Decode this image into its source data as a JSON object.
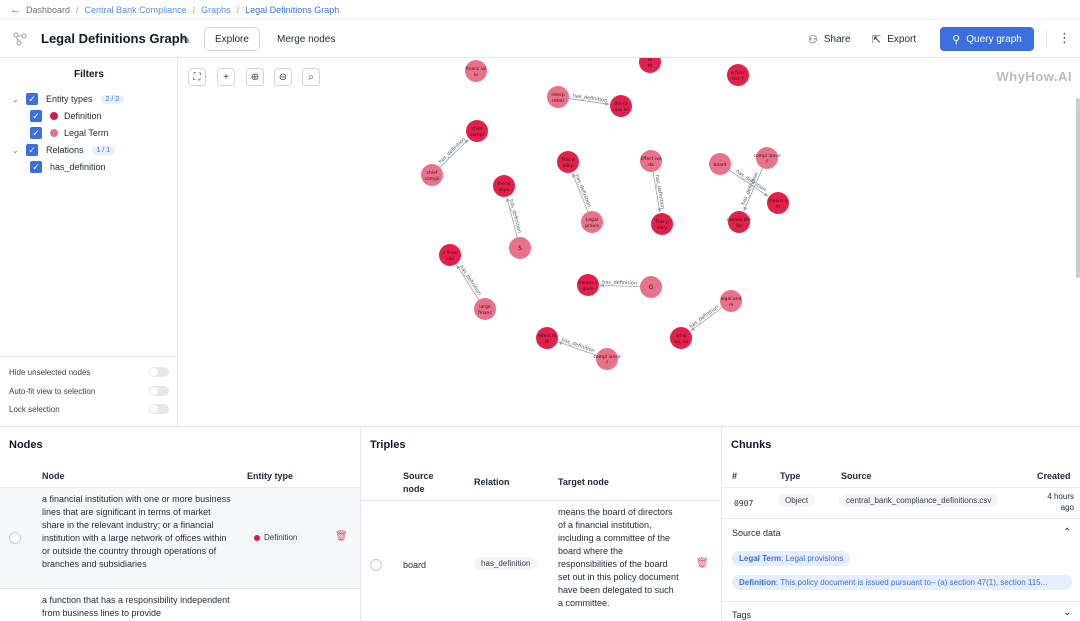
{
  "breadcrumb": {
    "back_label": "Dashboard",
    "items": [
      "Central Bank Compliance",
      "Graphs",
      "Legal Definitions Graph"
    ]
  },
  "header": {
    "title": "Legal Definitions Graph",
    "tabs": [
      "Explore",
      "Merge nodes"
    ],
    "share_label": "Share",
    "export_label": "Export",
    "query_label": "Query graph"
  },
  "filters": {
    "title": "Filters",
    "entity_types_label": "Entity types",
    "entity_types_count": "2 / 2",
    "entity_items": [
      {
        "label": "Definition",
        "color": "#d81b44"
      },
      {
        "label": "Legal Term",
        "color": "#ea6f87"
      }
    ],
    "relations_label": "Relations",
    "relations_count": "1 / 1",
    "relation_items": [
      "has_definition"
    ],
    "toggles": [
      "Hide unselected nodes",
      "Auto-fit view to selection",
      "Lock selection"
    ]
  },
  "canvas": {
    "watermark": "WhyHow.AI",
    "colors": {
      "definition": "#e2214b",
      "legal_term": "#e9728a",
      "edge": "#9ca3af"
    },
    "edge_label": "has_definition",
    "nodes": [
      {
        "id": "n1",
        "label": "financ ial in",
        "kind": "legal_term"
      },
      {
        "id": "n2",
        "label": "to th",
        "kind": "definition"
      },
      {
        "id": "n3",
        "label": "a func tion t",
        "kind": "definition"
      },
      {
        "id": "n4",
        "label": "interp retati",
        "kind": "legal_term"
      },
      {
        "id": "n5",
        "label": "the (a ress an",
        "kind": "definition"
      },
      {
        "id": "n6",
        "label": "chief compl",
        "kind": "definition"
      },
      {
        "id": "n7",
        "label": "chief compli",
        "kind": "legal_term"
      },
      {
        "id": "n8",
        "label": "This p olicy",
        "kind": "definition"
      },
      {
        "id": "n9",
        "label": "Effect ive da",
        "kind": "legal_term"
      },
      {
        "id": "n10",
        "label": "board",
        "kind": "legal_term"
      },
      {
        "id": "n11",
        "label": "compl iance f",
        "kind": "legal_term"
      },
      {
        "id": "n12",
        "label": "means a m",
        "kind": "definition"
      },
      {
        "id": "n13",
        "label": "Legal provis",
        "kind": "legal_term"
      },
      {
        "id": "n14",
        "label": "This p olicy",
        "kind": "definition"
      },
      {
        "id": "n15",
        "label": "means the bo",
        "kind": "definition"
      },
      {
        "id": "n16",
        "label": "the in depe",
        "kind": "definition"
      },
      {
        "id": "n17",
        "label": "S",
        "kind": "legal_term"
      },
      {
        "id": "n18",
        "label": "a finan cial",
        "kind": "definition"
      },
      {
        "id": "n19",
        "label": "means s gove",
        "kind": "definition"
      },
      {
        "id": "n20",
        "label": "G",
        "kind": "legal_term"
      },
      {
        "id": "n21",
        "label": "legal and re",
        "kind": "legal_term"
      },
      {
        "id": "n22",
        "label": "large financ",
        "kind": "legal_term"
      },
      {
        "id": "n23",
        "label": "all la ws, ru",
        "kind": "definition"
      },
      {
        "id": "n24",
        "label": "refers to th",
        "kind": "definition"
      },
      {
        "id": "n25",
        "label": "compl iance f",
        "kind": "legal_term"
      }
    ]
  },
  "nodes_panel": {
    "title": "Nodes",
    "columns": [
      "Node",
      "Entity type"
    ],
    "rows": [
      {
        "text": "a financial institution with one or more business lines that are significant in terms of market share in the relevant industry; or a financial institution with a large network of offices within or outside the country through operations of branches and subsidiaries",
        "type": "Definition"
      },
      {
        "text": "a function that has a responsibility independent from business lines to provide",
        "type": ""
      }
    ]
  },
  "triples_panel": {
    "title": "Triples",
    "columns": [
      "Source node",
      "Relation",
      "Target node"
    ],
    "rows": [
      {
        "source": "board",
        "relation": "has_definition",
        "target": "means the board of directors of a financial institution, including a committee of the board where the responsibilities of the board set out in this policy document have been delegated to such a committee."
      }
    ]
  },
  "chunks_panel": {
    "title": "Chunks",
    "columns": [
      "#",
      "Type",
      "Source",
      "Created"
    ],
    "row": {
      "id": "0907",
      "type": "Object",
      "source": "central_bank_compliance_definitions.csv",
      "created": "4 hours ago"
    },
    "source_data_label": "Source data",
    "source_data": [
      {
        "key": "Legal Term",
        "value": "Legal provisions"
      },
      {
        "key": "Definition",
        "value": "This policy document is issued pursuant to– (a) section 47(1), section 115..."
      }
    ],
    "tags_label": "Tags"
  }
}
